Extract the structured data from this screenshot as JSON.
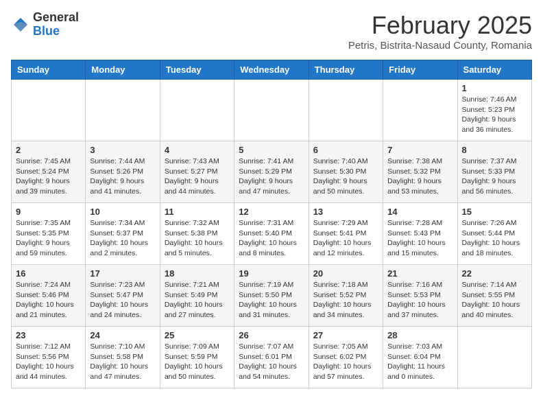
{
  "logo": {
    "general": "General",
    "blue": "Blue"
  },
  "header": {
    "month_year": "February 2025",
    "location": "Petris, Bistrita-Nasaud County, Romania"
  },
  "days_of_week": [
    "Sunday",
    "Monday",
    "Tuesday",
    "Wednesday",
    "Thursday",
    "Friday",
    "Saturday"
  ],
  "weeks": [
    [
      {
        "day": "",
        "info": ""
      },
      {
        "day": "",
        "info": ""
      },
      {
        "day": "",
        "info": ""
      },
      {
        "day": "",
        "info": ""
      },
      {
        "day": "",
        "info": ""
      },
      {
        "day": "",
        "info": ""
      },
      {
        "day": "1",
        "info": "Sunrise: 7:46 AM\nSunset: 5:23 PM\nDaylight: 9 hours and 36 minutes."
      }
    ],
    [
      {
        "day": "2",
        "info": "Sunrise: 7:45 AM\nSunset: 5:24 PM\nDaylight: 9 hours and 39 minutes."
      },
      {
        "day": "3",
        "info": "Sunrise: 7:44 AM\nSunset: 5:26 PM\nDaylight: 9 hours and 41 minutes."
      },
      {
        "day": "4",
        "info": "Sunrise: 7:43 AM\nSunset: 5:27 PM\nDaylight: 9 hours and 44 minutes."
      },
      {
        "day": "5",
        "info": "Sunrise: 7:41 AM\nSunset: 5:29 PM\nDaylight: 9 hours and 47 minutes."
      },
      {
        "day": "6",
        "info": "Sunrise: 7:40 AM\nSunset: 5:30 PM\nDaylight: 9 hours and 50 minutes."
      },
      {
        "day": "7",
        "info": "Sunrise: 7:38 AM\nSunset: 5:32 PM\nDaylight: 9 hours and 53 minutes."
      },
      {
        "day": "8",
        "info": "Sunrise: 7:37 AM\nSunset: 5:33 PM\nDaylight: 9 hours and 56 minutes."
      }
    ],
    [
      {
        "day": "9",
        "info": "Sunrise: 7:35 AM\nSunset: 5:35 PM\nDaylight: 9 hours and 59 minutes."
      },
      {
        "day": "10",
        "info": "Sunrise: 7:34 AM\nSunset: 5:37 PM\nDaylight: 10 hours and 2 minutes."
      },
      {
        "day": "11",
        "info": "Sunrise: 7:32 AM\nSunset: 5:38 PM\nDaylight: 10 hours and 5 minutes."
      },
      {
        "day": "12",
        "info": "Sunrise: 7:31 AM\nSunset: 5:40 PM\nDaylight: 10 hours and 8 minutes."
      },
      {
        "day": "13",
        "info": "Sunrise: 7:29 AM\nSunset: 5:41 PM\nDaylight: 10 hours and 12 minutes."
      },
      {
        "day": "14",
        "info": "Sunrise: 7:28 AM\nSunset: 5:43 PM\nDaylight: 10 hours and 15 minutes."
      },
      {
        "day": "15",
        "info": "Sunrise: 7:26 AM\nSunset: 5:44 PM\nDaylight: 10 hours and 18 minutes."
      }
    ],
    [
      {
        "day": "16",
        "info": "Sunrise: 7:24 AM\nSunset: 5:46 PM\nDaylight: 10 hours and 21 minutes."
      },
      {
        "day": "17",
        "info": "Sunrise: 7:23 AM\nSunset: 5:47 PM\nDaylight: 10 hours and 24 minutes."
      },
      {
        "day": "18",
        "info": "Sunrise: 7:21 AM\nSunset: 5:49 PM\nDaylight: 10 hours and 27 minutes."
      },
      {
        "day": "19",
        "info": "Sunrise: 7:19 AM\nSunset: 5:50 PM\nDaylight: 10 hours and 31 minutes."
      },
      {
        "day": "20",
        "info": "Sunrise: 7:18 AM\nSunset: 5:52 PM\nDaylight: 10 hours and 34 minutes."
      },
      {
        "day": "21",
        "info": "Sunrise: 7:16 AM\nSunset: 5:53 PM\nDaylight: 10 hours and 37 minutes."
      },
      {
        "day": "22",
        "info": "Sunrise: 7:14 AM\nSunset: 5:55 PM\nDaylight: 10 hours and 40 minutes."
      }
    ],
    [
      {
        "day": "23",
        "info": "Sunrise: 7:12 AM\nSunset: 5:56 PM\nDaylight: 10 hours and 44 minutes."
      },
      {
        "day": "24",
        "info": "Sunrise: 7:10 AM\nSunset: 5:58 PM\nDaylight: 10 hours and 47 minutes."
      },
      {
        "day": "25",
        "info": "Sunrise: 7:09 AM\nSunset: 5:59 PM\nDaylight: 10 hours and 50 minutes."
      },
      {
        "day": "26",
        "info": "Sunrise: 7:07 AM\nSunset: 6:01 PM\nDaylight: 10 hours and 54 minutes."
      },
      {
        "day": "27",
        "info": "Sunrise: 7:05 AM\nSunset: 6:02 PM\nDaylight: 10 hours and 57 minutes."
      },
      {
        "day": "28",
        "info": "Sunrise: 7:03 AM\nSunset: 6:04 PM\nDaylight: 11 hours and 0 minutes."
      },
      {
        "day": "",
        "info": ""
      }
    ]
  ]
}
